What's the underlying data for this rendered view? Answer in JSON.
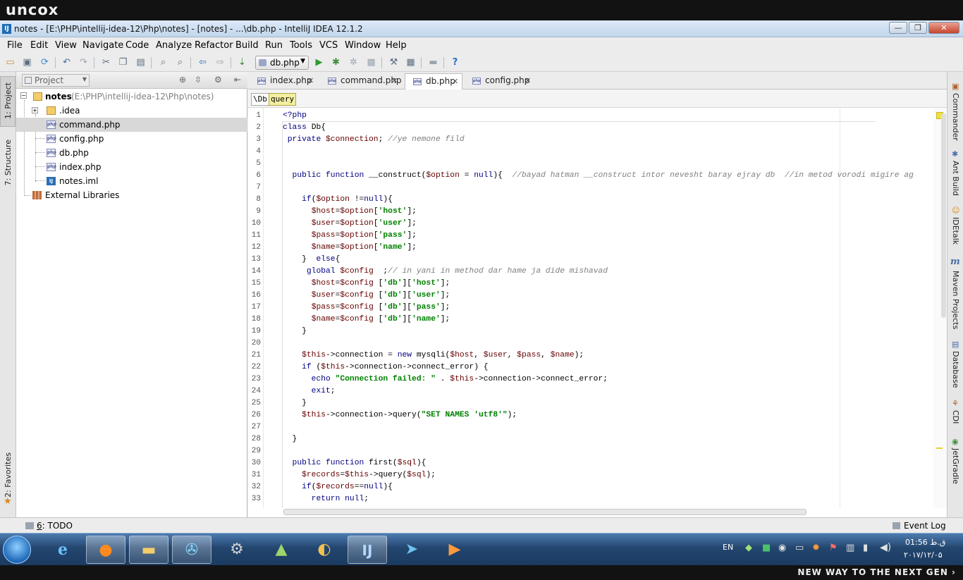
{
  "overlay": {
    "brand": "uncox",
    "slogan": "NEW WAY TO THE NEXT GEN ›"
  },
  "window": {
    "title": "notes - [E:\\PHP\\intellij-idea-12\\Php\\notes] - [notes] - ...\\db.php - IntelliJ IDEA 12.1.2",
    "app_icon": "IJ",
    "controls": {
      "minimize": "—",
      "maximize": "❐",
      "close": "✕"
    }
  },
  "menu": [
    "File",
    "Edit",
    "View",
    "Navigate",
    "Code",
    "Analyze",
    "Refactor",
    "Build",
    "Run",
    "Tools",
    "VCS",
    "Window",
    "Help"
  ],
  "toolbar": {
    "run_config": "db.php",
    "help": "?"
  },
  "left_strip": {
    "project": "1: Project",
    "structure": "7: Structure",
    "favorites": "2: Favorites"
  },
  "right_strip": {
    "commander": "Commander",
    "ant": "Ant Build",
    "idetalk": "IDEtalk",
    "maven": "Maven Projects",
    "database": "Database",
    "cdi": "CDI",
    "jetgradle": "JetGradle"
  },
  "project": {
    "view": "Project",
    "root_name": "notes",
    "root_path": "(E:\\PHP\\intellij-idea-12\\Php\\notes)",
    "items": [
      {
        "name": ".idea",
        "type": "folder"
      },
      {
        "name": "command.php",
        "type": "php"
      },
      {
        "name": "config.php",
        "type": "php"
      },
      {
        "name": "db.php",
        "type": "php"
      },
      {
        "name": "index.php",
        "type": "php"
      },
      {
        "name": "notes.iml",
        "type": "iml"
      }
    ],
    "external": "External Libraries",
    "selected": "command.php"
  },
  "editor": {
    "tabs": [
      "index.php",
      "command.php",
      "db.php",
      "config.php"
    ],
    "active_tab": "db.php",
    "breadcrumb": [
      "\\Db",
      "query"
    ],
    "line_numbers": [
      "1",
      "2",
      "3",
      "4",
      "5",
      "6",
      "7",
      "8",
      "9",
      "10",
      "11",
      "12",
      "13",
      "14",
      "15",
      "16",
      "17",
      "18",
      "19",
      "20",
      "21",
      "22",
      "23",
      "24",
      "25",
      "26",
      "27",
      "28",
      "29",
      "30",
      "31",
      "32",
      "33"
    ],
    "lines": [
      [
        {
          "t": "<?php",
          "c": "kw"
        }
      ],
      [
        {
          "t": "class ",
          "c": "kw"
        },
        {
          "t": "Db{",
          "c": "fn"
        }
      ],
      [
        {
          "t": " private ",
          "c": "kw"
        },
        {
          "t": "$connection",
          "c": "vr"
        },
        {
          "t": "; ",
          "c": "fn"
        },
        {
          "t": "//ye nemone fild",
          "c": "cm"
        }
      ],
      [],
      [],
      [
        {
          "t": "  public function ",
          "c": "kw"
        },
        {
          "t": "__construct(",
          "c": "fn"
        },
        {
          "t": "$option",
          "c": "vr"
        },
        {
          "t": " = ",
          "c": "fn"
        },
        {
          "t": "null",
          "c": "kw"
        },
        {
          "t": "){  ",
          "c": "fn"
        },
        {
          "t": "//bayad hatman __construct intor nevesht baray ejray db  //in metod vorodi migire ag",
          "c": "cm"
        }
      ],
      [],
      [
        {
          "t": "    if",
          "c": "kw"
        },
        {
          "t": "(",
          "c": "fn"
        },
        {
          "t": "$option",
          "c": "vr"
        },
        {
          "t": " !=",
          "c": "fn"
        },
        {
          "t": "null",
          "c": "kw"
        },
        {
          "t": "){",
          "c": "fn"
        }
      ],
      [
        {
          "t": "      ",
          "c": "fn"
        },
        {
          "t": "$host",
          "c": "vr"
        },
        {
          "t": "=",
          "c": "fn"
        },
        {
          "t": "$option",
          "c": "vr"
        },
        {
          "t": "[",
          "c": "fn"
        },
        {
          "t": "'host'",
          "c": "st"
        },
        {
          "t": "];",
          "c": "fn"
        }
      ],
      [
        {
          "t": "      ",
          "c": "fn"
        },
        {
          "t": "$user",
          "c": "vr"
        },
        {
          "t": "=",
          "c": "fn"
        },
        {
          "t": "$option",
          "c": "vr"
        },
        {
          "t": "[",
          "c": "fn"
        },
        {
          "t": "'user'",
          "c": "st"
        },
        {
          "t": "];",
          "c": "fn"
        }
      ],
      [
        {
          "t": "      ",
          "c": "fn"
        },
        {
          "t": "$pass",
          "c": "vr"
        },
        {
          "t": "=",
          "c": "fn"
        },
        {
          "t": "$option",
          "c": "vr"
        },
        {
          "t": "[",
          "c": "fn"
        },
        {
          "t": "'pass'",
          "c": "st"
        },
        {
          "t": "];",
          "c": "fn"
        }
      ],
      [
        {
          "t": "      ",
          "c": "fn"
        },
        {
          "t": "$name",
          "c": "vr"
        },
        {
          "t": "=",
          "c": "fn"
        },
        {
          "t": "$option",
          "c": "vr"
        },
        {
          "t": "[",
          "c": "fn"
        },
        {
          "t": "'name'",
          "c": "st"
        },
        {
          "t": "];",
          "c": "fn"
        }
      ],
      [
        {
          "t": "    }  ",
          "c": "fn"
        },
        {
          "t": "else",
          "c": "kw"
        },
        {
          "t": "{",
          "c": "fn"
        }
      ],
      [
        {
          "t": "     global ",
          "c": "kw"
        },
        {
          "t": "$config",
          "c": "vr"
        },
        {
          "t": "  ;",
          "c": "fn"
        },
        {
          "t": "// in yani in method dar hame ja dide mishavad",
          "c": "cm"
        }
      ],
      [
        {
          "t": "      ",
          "c": "fn"
        },
        {
          "t": "$host",
          "c": "vr"
        },
        {
          "t": "=",
          "c": "fn"
        },
        {
          "t": "$config",
          "c": "vr"
        },
        {
          "t": " [",
          "c": "fn"
        },
        {
          "t": "'db'",
          "c": "st"
        },
        {
          "t": "][",
          "c": "fn"
        },
        {
          "t": "'host'",
          "c": "st"
        },
        {
          "t": "];",
          "c": "fn"
        }
      ],
      [
        {
          "t": "      ",
          "c": "fn"
        },
        {
          "t": "$user",
          "c": "vr"
        },
        {
          "t": "=",
          "c": "fn"
        },
        {
          "t": "$config",
          "c": "vr"
        },
        {
          "t": " [",
          "c": "fn"
        },
        {
          "t": "'db'",
          "c": "st"
        },
        {
          "t": "][",
          "c": "fn"
        },
        {
          "t": "'user'",
          "c": "st"
        },
        {
          "t": "];",
          "c": "fn"
        }
      ],
      [
        {
          "t": "      ",
          "c": "fn"
        },
        {
          "t": "$pass",
          "c": "vr"
        },
        {
          "t": "=",
          "c": "fn"
        },
        {
          "t": "$config",
          "c": "vr"
        },
        {
          "t": " [",
          "c": "fn"
        },
        {
          "t": "'db'",
          "c": "st"
        },
        {
          "t": "][",
          "c": "fn"
        },
        {
          "t": "'pass'",
          "c": "st"
        },
        {
          "t": "];",
          "c": "fn"
        }
      ],
      [
        {
          "t": "      ",
          "c": "fn"
        },
        {
          "t": "$name",
          "c": "vr"
        },
        {
          "t": "=",
          "c": "fn"
        },
        {
          "t": "$config",
          "c": "vr"
        },
        {
          "t": " [",
          "c": "fn"
        },
        {
          "t": "'db'",
          "c": "st"
        },
        {
          "t": "][",
          "c": "fn"
        },
        {
          "t": "'name'",
          "c": "st"
        },
        {
          "t": "];",
          "c": "fn"
        }
      ],
      [
        {
          "t": "    }",
          "c": "fn"
        }
      ],
      [],
      [
        {
          "t": "    ",
          "c": "fn"
        },
        {
          "t": "$this",
          "c": "vr"
        },
        {
          "t": "->connection = ",
          "c": "fn"
        },
        {
          "t": "new ",
          "c": "kw"
        },
        {
          "t": "mysqli(",
          "c": "fn"
        },
        {
          "t": "$host",
          "c": "vr"
        },
        {
          "t": ", ",
          "c": "fn"
        },
        {
          "t": "$user",
          "c": "vr"
        },
        {
          "t": ", ",
          "c": "fn"
        },
        {
          "t": "$pass",
          "c": "vr"
        },
        {
          "t": ", ",
          "c": "fn"
        },
        {
          "t": "$name",
          "c": "vr"
        },
        {
          "t": ");",
          "c": "fn"
        }
      ],
      [
        {
          "t": "    if ",
          "c": "kw"
        },
        {
          "t": "(",
          "c": "fn"
        },
        {
          "t": "$this",
          "c": "vr"
        },
        {
          "t": "->connection->connect_error) {",
          "c": "fn"
        }
      ],
      [
        {
          "t": "      echo ",
          "c": "kw"
        },
        {
          "t": "\"Connection failed: \"",
          "c": "st"
        },
        {
          "t": " . ",
          "c": "fn"
        },
        {
          "t": "$this",
          "c": "vr"
        },
        {
          "t": "->connection->connect_error;",
          "c": "fn"
        }
      ],
      [
        {
          "t": "      exit",
          "c": "kw"
        },
        {
          "t": ";",
          "c": "fn"
        }
      ],
      [
        {
          "t": "    }",
          "c": "fn"
        }
      ],
      [
        {
          "t": "    ",
          "c": "fn"
        },
        {
          "t": "$this",
          "c": "vr"
        },
        {
          "t": "->connection->query(",
          "c": "fn"
        },
        {
          "t": "\"SET NAMES 'utf8'\"",
          "c": "st"
        },
        {
          "t": ");",
          "c": "fn"
        }
      ],
      [],
      [
        {
          "t": "  }",
          "c": "fn"
        }
      ],
      [],
      [
        {
          "t": "  public function ",
          "c": "kw"
        },
        {
          "t": "first(",
          "c": "fn"
        },
        {
          "t": "$sql",
          "c": "vr"
        },
        {
          "t": "){",
          "c": "fn"
        }
      ],
      [
        {
          "t": "    ",
          "c": "fn"
        },
        {
          "t": "$records",
          "c": "vr"
        },
        {
          "t": "=",
          "c": "fn"
        },
        {
          "t": "$this",
          "c": "vr"
        },
        {
          "t": "->query(",
          "c": "fn"
        },
        {
          "t": "$sql",
          "c": "vr"
        },
        {
          "t": ");",
          "c": "fn"
        }
      ],
      [
        {
          "t": "    if",
          "c": "kw"
        },
        {
          "t": "(",
          "c": "fn"
        },
        {
          "t": "$records",
          "c": "vr"
        },
        {
          "t": "==",
          "c": "fn"
        },
        {
          "t": "null",
          "c": "kw"
        },
        {
          "t": "){",
          "c": "fn"
        }
      ],
      [
        {
          "t": "      return null",
          "c": "kw"
        },
        {
          "t": ";",
          "c": "fn"
        }
      ]
    ]
  },
  "status": {
    "todo_key": "6",
    "todo_label": ": TODO",
    "event_log": "Event Log"
  },
  "taskbar": {
    "lang": "EN",
    "time": "01:56 ق.ظ",
    "date": "۲۰۱۷/۱۲/۰۵"
  },
  "colors": {
    "keyword": "#000080",
    "variable": "#660000",
    "string": "#008000",
    "comment": "#808080"
  }
}
